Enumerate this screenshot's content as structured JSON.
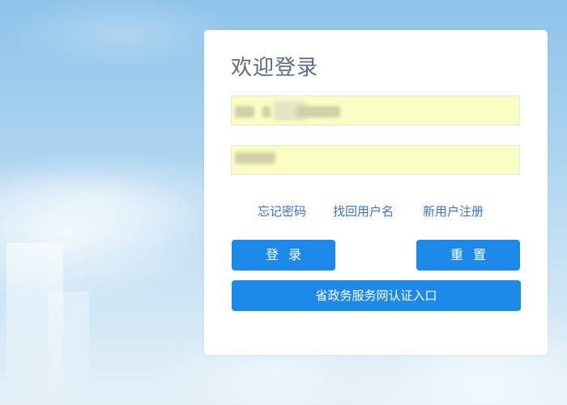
{
  "login": {
    "title": "欢迎登录",
    "username_value": "",
    "password_value": "",
    "links": {
      "forgot_password": "忘记密码",
      "recover_username": "找回用户名",
      "register": "新用户注册"
    },
    "buttons": {
      "login": "登录",
      "reset": "重置",
      "portal": "省政务服务网认证入口"
    }
  },
  "colors": {
    "accent": "#1d8ae9",
    "link": "#3a73c8",
    "title": "#5c6b80",
    "field_bg": "#fbfec2"
  }
}
